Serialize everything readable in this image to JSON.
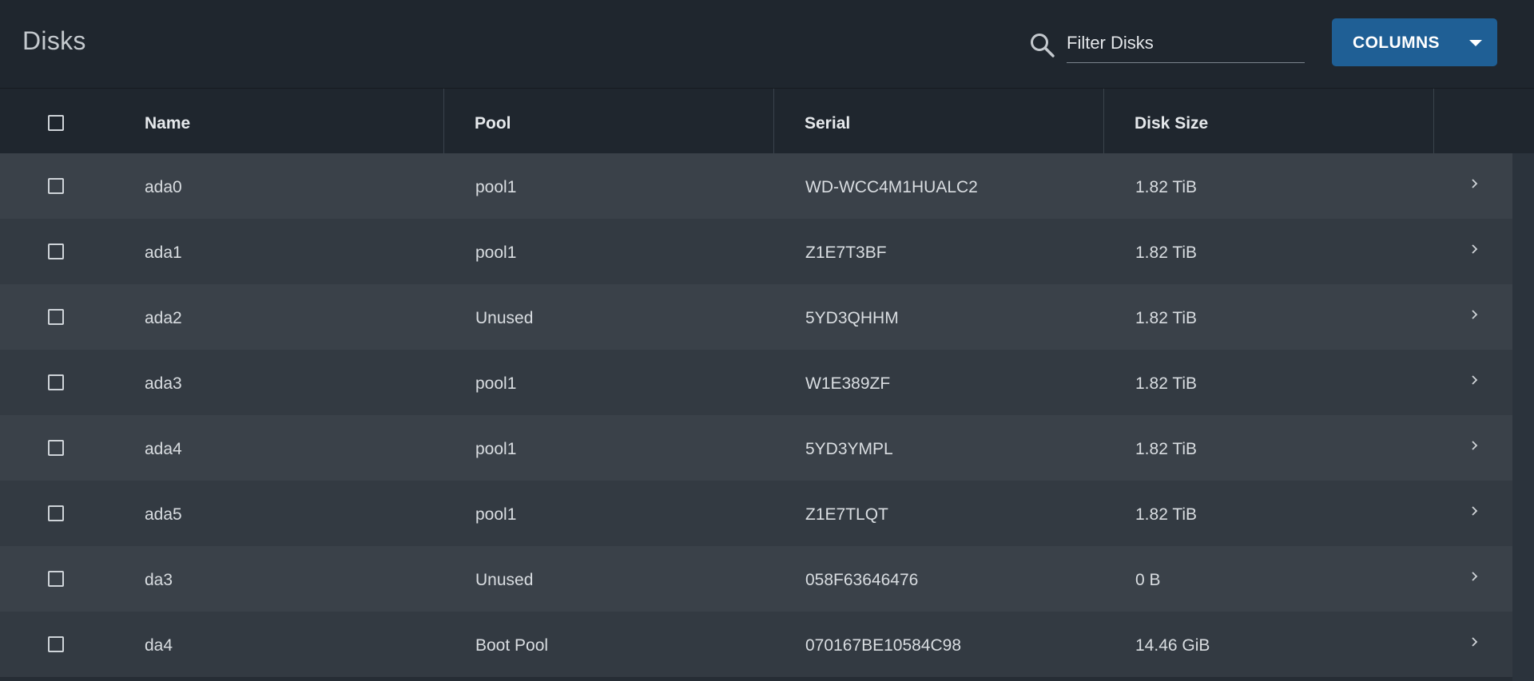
{
  "header": {
    "title": "Disks",
    "search_icon": "search-icon",
    "filter_placeholder": "Filter Disks",
    "filter_value": "",
    "columns_label": "COLUMNS",
    "accent": "#1f5f95"
  },
  "table": {
    "columns": [
      "Name",
      "Pool",
      "Serial",
      "Disk Size"
    ],
    "rows": [
      {
        "name": "ada0",
        "pool": "pool1",
        "serial": "WD-WCC4M1HUALC2",
        "size": "1.82 TiB"
      },
      {
        "name": "ada1",
        "pool": "pool1",
        "serial": "Z1E7T3BF",
        "size": "1.82 TiB"
      },
      {
        "name": "ada2",
        "pool": "Unused",
        "serial": "5YD3QHHM",
        "size": "1.82 TiB"
      },
      {
        "name": "ada3",
        "pool": "pool1",
        "serial": "W1E389ZF",
        "size": "1.82 TiB"
      },
      {
        "name": "ada4",
        "pool": "pool1",
        "serial": "5YD3YMPL",
        "size": "1.82 TiB"
      },
      {
        "name": "ada5",
        "pool": "pool1",
        "serial": "Z1E7TLQT",
        "size": "1.82 TiB"
      },
      {
        "name": "da3",
        "pool": "Unused",
        "serial": "058F63646476",
        "size": "0 B"
      },
      {
        "name": "da4",
        "pool": "Boot Pool",
        "serial": "070167BE10584C98",
        "size": "14.46 GiB"
      }
    ]
  }
}
